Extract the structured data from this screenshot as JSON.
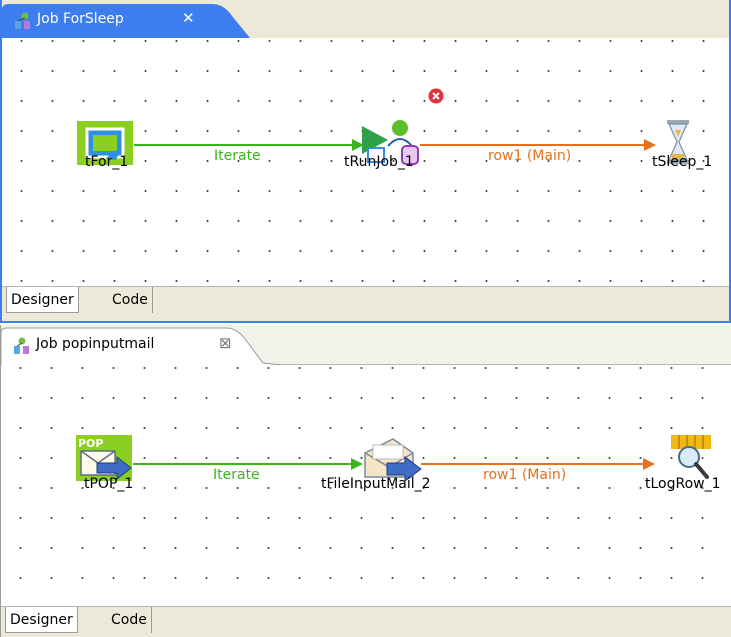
{
  "jobs": [
    {
      "tab_title": "Job ForSleep",
      "close_glyph": "✕",
      "active": true,
      "nodes": [
        "tFor_1",
        "tRunJob_1",
        "tSleep_1"
      ],
      "links": [
        "Iterate",
        "row1 (Main)"
      ],
      "bottom_tabs": [
        "Designer",
        "Code"
      ]
    },
    {
      "tab_title": "Job popinputmail",
      "close_glyph": "⊠",
      "active": false,
      "nodes": [
        "tPOP_1",
        "tFileInputMail_2",
        "tLogRow_1"
      ],
      "links": [
        "Iterate",
        "row1 (Main)"
      ],
      "bottom_tabs": [
        "Designer",
        "Code"
      ]
    }
  ],
  "colors": {
    "accent": "#3d7df0",
    "iterate": "#39b51c",
    "main": "#e4701c",
    "error": "#e0303a"
  },
  "icons": {
    "job_tab": "job-icon",
    "tfor": "loop-icon",
    "trunjob": "run-job-icon",
    "tsleep": "hourglass-icon",
    "tpop": "pop-mail-icon",
    "tfileinputmail": "mail-input-icon",
    "tlogrow": "log-row-icon",
    "error": "error-icon"
  }
}
